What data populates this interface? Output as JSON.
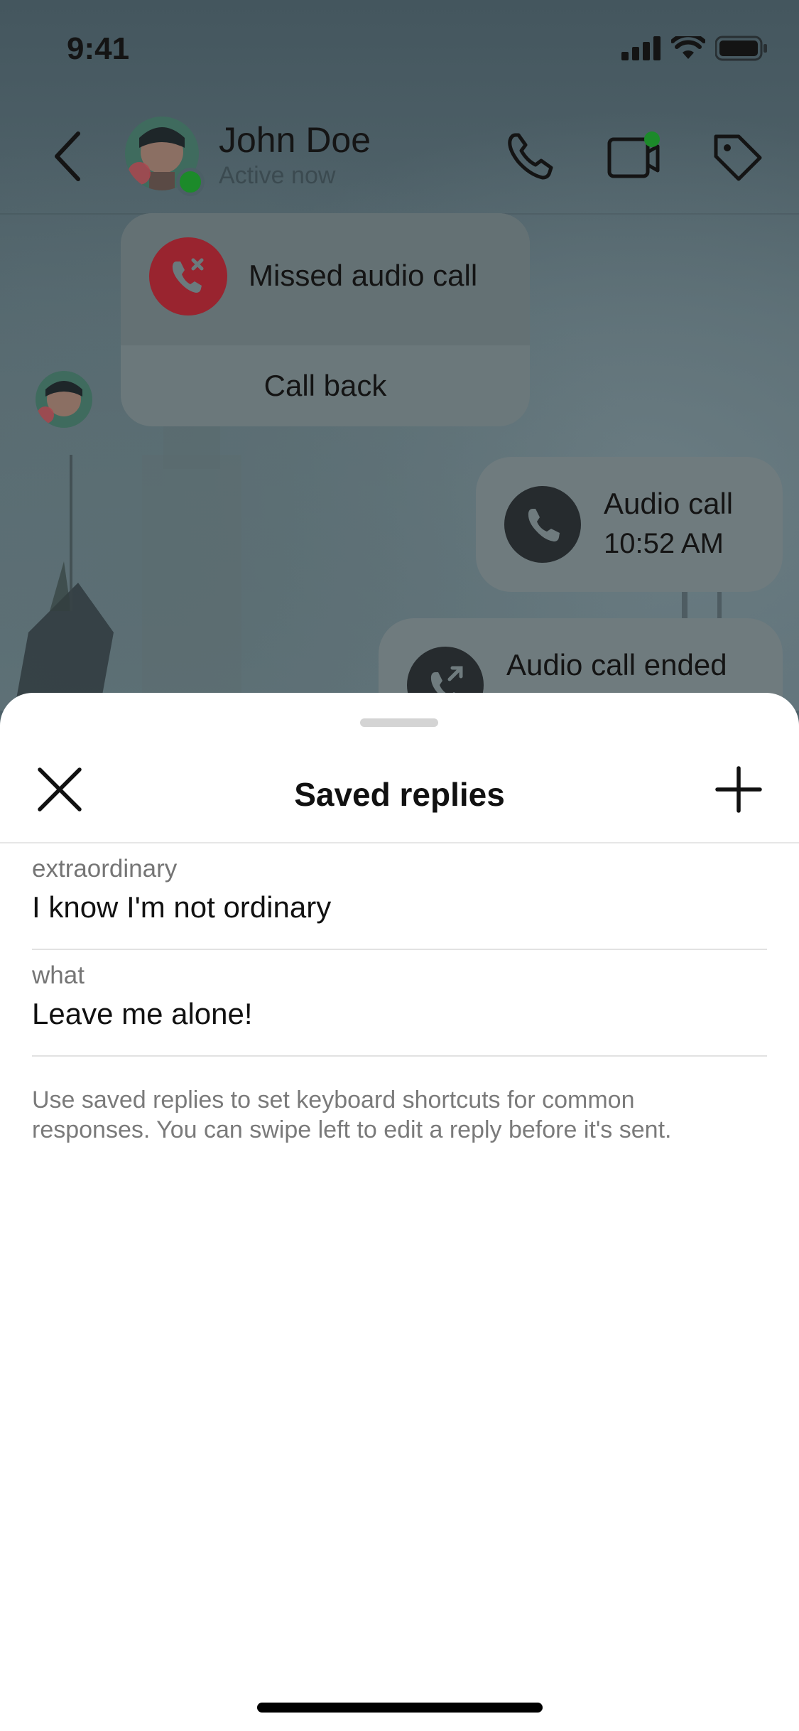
{
  "status_bar": {
    "time": "9:41"
  },
  "chat": {
    "contact_name": "John Doe",
    "contact_status": "Active now",
    "messages": {
      "missed_call_title": "Missed audio call",
      "call_back_label": "Call back",
      "audio_call_title": "Audio call",
      "audio_call_time": "10:52 AM",
      "call_ended_title": "Audio call ended"
    },
    "colors": {
      "missed_call_red": "#e0283c",
      "online_green": "#2bb24c"
    }
  },
  "sheet": {
    "title": "Saved replies",
    "close_icon": "close-icon",
    "add_icon": "plus-icon",
    "replies": [
      {
        "shortcut": "extraordinary",
        "message": "I know I'm not ordinary"
      },
      {
        "shortcut": "what",
        "message": "Leave me alone!"
      }
    ],
    "hint_line1": "Use saved replies to set keyboard shortcuts for common",
    "hint_line2": "responses. You can swipe left to edit a reply before it's sent."
  }
}
